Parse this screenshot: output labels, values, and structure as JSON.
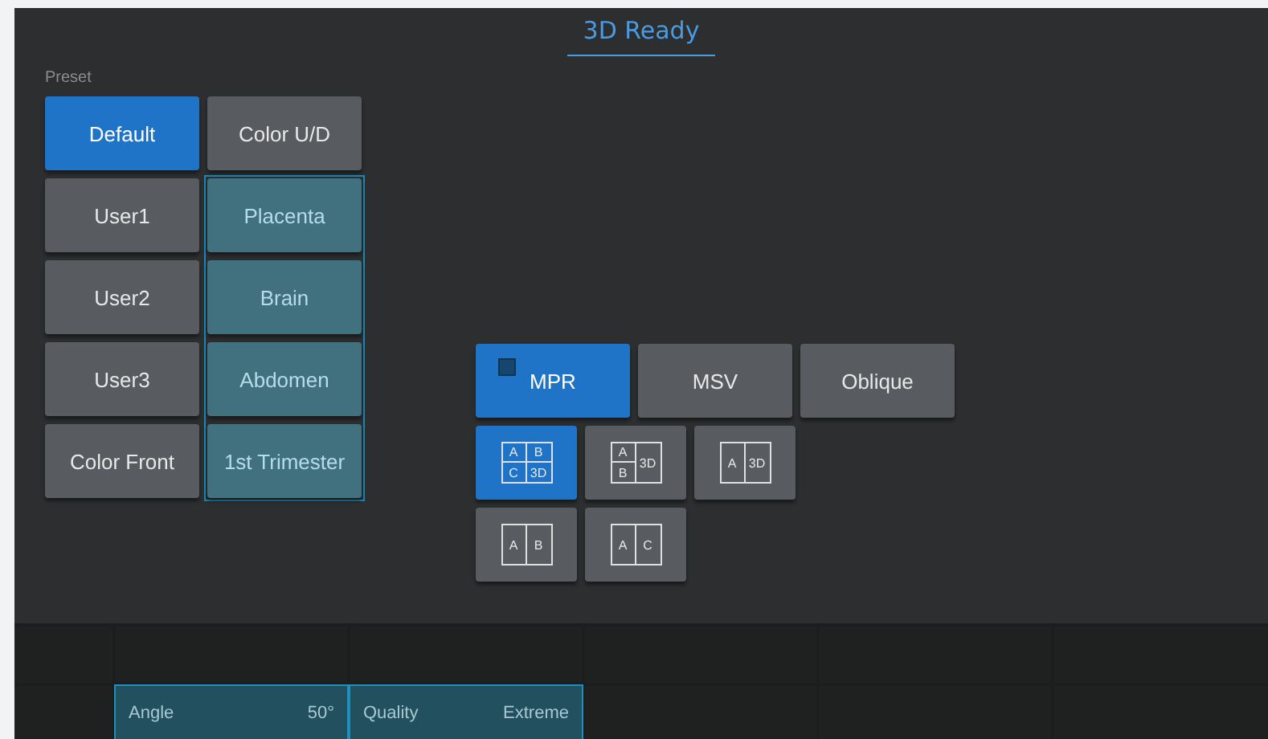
{
  "title": "3D Ready",
  "preset_label": "Preset",
  "preset_columns": [
    [
      {
        "label": "Default",
        "selected": true,
        "kind": "plain"
      },
      {
        "label": "User1",
        "selected": false,
        "kind": "plain"
      },
      {
        "label": "User2",
        "selected": false,
        "kind": "plain"
      },
      {
        "label": "User3",
        "selected": false,
        "kind": "plain"
      },
      {
        "label": "Color Front",
        "selected": false,
        "kind": "plain"
      }
    ],
    [
      {
        "label": "Color U/D",
        "selected": false,
        "kind": "plain"
      },
      {
        "label": "Placenta",
        "selected": false,
        "kind": "organ"
      },
      {
        "label": "Brain",
        "selected": false,
        "kind": "organ"
      },
      {
        "label": "Abdomen",
        "selected": false,
        "kind": "organ"
      },
      {
        "label": "1st Trimester",
        "selected": false,
        "kind": "organ"
      }
    ]
  ],
  "view_modes": [
    {
      "label": "MPR",
      "selected": true
    },
    {
      "label": "MSV",
      "selected": false
    },
    {
      "label": "Oblique",
      "selected": false
    }
  ],
  "layouts": [
    [
      {
        "kind": "quad",
        "cells": [
          "A",
          "B",
          "C",
          "3D"
        ],
        "selected": true
      },
      {
        "kind": "stack",
        "cells": [
          "A",
          "B",
          "3D"
        ],
        "selected": false
      },
      {
        "kind": "split",
        "cells": [
          "A",
          "3D"
        ],
        "selected": false
      }
    ],
    [
      {
        "kind": "split",
        "cells": [
          "A",
          "B"
        ],
        "selected": false
      },
      {
        "kind": "split",
        "cells": [
          "A",
          "C"
        ],
        "selected": false
      }
    ]
  ],
  "parameters": [
    {
      "label": "Angle",
      "value": "50°"
    },
    {
      "label": "Quality",
      "value": "Extreme"
    }
  ]
}
